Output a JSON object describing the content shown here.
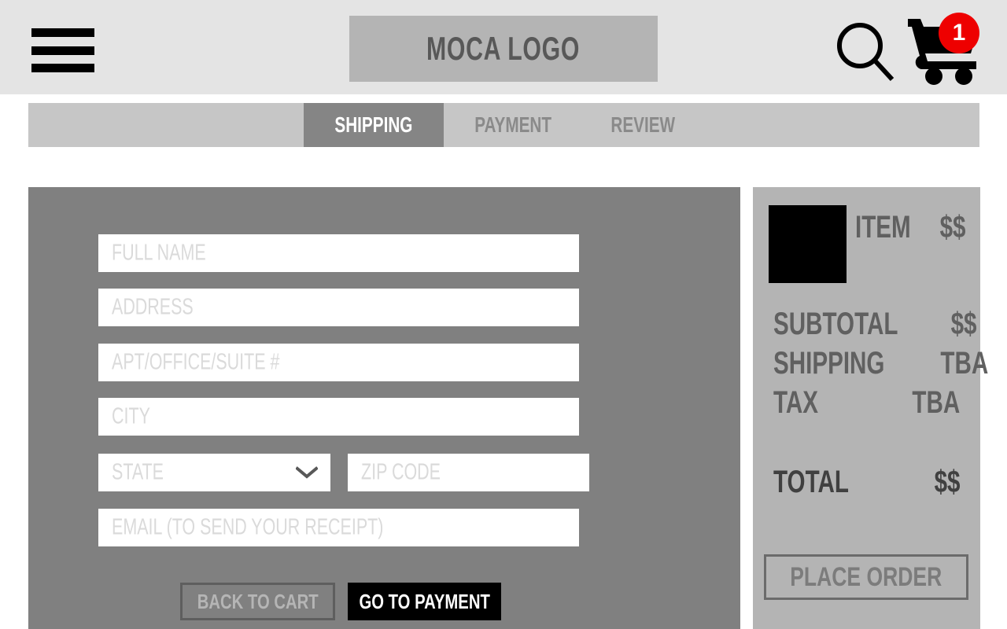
{
  "header": {
    "menu_icon": "hamburger-menu-icon",
    "logo_text": "MOCA LOGO",
    "search_icon": "search-icon",
    "cart_icon": "shopping-cart-icon",
    "cart_badge_count": "1",
    "badge_color": "#ee0000",
    "background_color": "#e4e4e4",
    "logo_background_color": "#b4b4b4"
  },
  "checkout_steps": {
    "background_color": "#c6c6c6",
    "active_background_color": "#858585",
    "tabs": [
      {
        "label": "SHIPPING",
        "active": true
      },
      {
        "label": "PAYMENT",
        "active": false
      },
      {
        "label": "REVIEW",
        "active": false
      }
    ]
  },
  "shipping_form": {
    "background_color": "#808080",
    "fields": [
      {
        "name": "full-name",
        "placeholder": "FULL NAME",
        "value": ""
      },
      {
        "name": "address",
        "placeholder": "ADDRESS",
        "value": ""
      },
      {
        "name": "apt-office-suite",
        "placeholder": "APT/OFFICE/SUITE #",
        "value": ""
      },
      {
        "name": "city",
        "placeholder": "CITY",
        "value": ""
      },
      {
        "name": "state",
        "placeholder": "STATE",
        "value": ""
      },
      {
        "name": "zip-code",
        "placeholder": "ZIP CODE",
        "value": ""
      },
      {
        "name": "email",
        "placeholder": "EMAIL (TO SEND YOUR RECEIPT)",
        "value": ""
      }
    ],
    "state_dropdown_icon": "chevron-down-icon",
    "buttons": {
      "back_label": "BACK TO CART",
      "forward_label": "GO TO PAYMENT"
    }
  },
  "order_summary": {
    "background_color": "#b4b4b4",
    "thumbnail_color": "#000000",
    "item": {
      "label": "ITEM",
      "price": "$$"
    },
    "lines": [
      {
        "label": "SUBTOTAL",
        "value": "$$"
      },
      {
        "label": "SHIPPING",
        "value": "TBA"
      },
      {
        "label": "TAX",
        "value": "TBA"
      }
    ],
    "total": {
      "label": "TOTAL",
      "value": "$$"
    },
    "place_order_label": "PLACE ORDER"
  }
}
